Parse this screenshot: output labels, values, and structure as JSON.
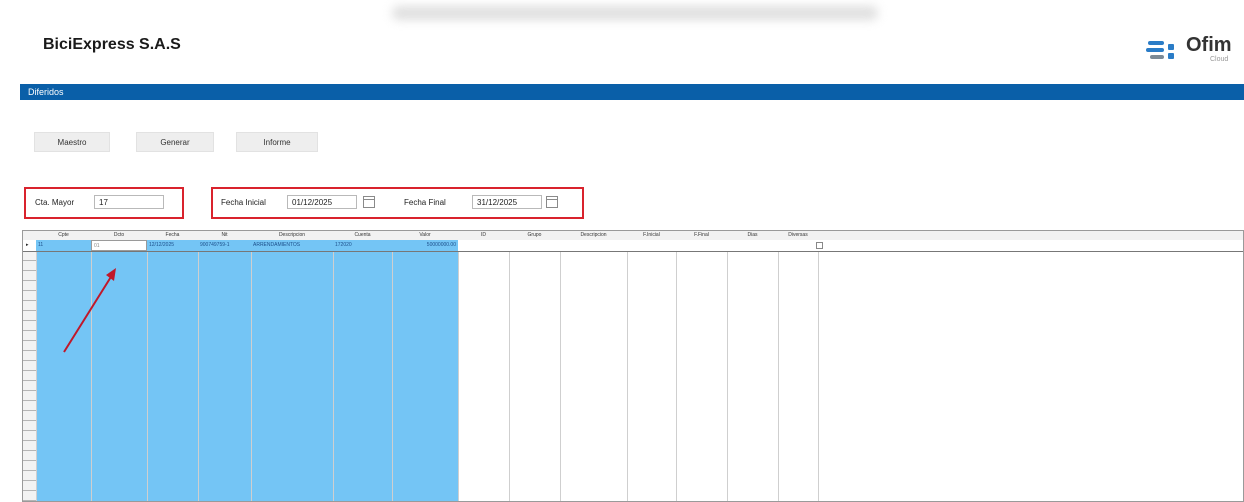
{
  "company": {
    "name": "BiciExpress S.A.S"
  },
  "logo": {
    "text": "Ofim",
    "subtitle": "Cloud",
    "icon": "ofima-logo-icon"
  },
  "window": {
    "title": "Diferidos"
  },
  "menu": [
    {
      "label": "Maestro"
    },
    {
      "label": "Generar"
    },
    {
      "label": "Informe"
    }
  ],
  "filters": {
    "cta_mayor_label": "Cta. Mayor",
    "cta_mayor_value": "17",
    "fecha_inicial_label": "Fecha Inicial",
    "fecha_inicial_value": "01/12/2025",
    "fecha_final_label": "Fecha Final",
    "fecha_final_value": "31/12/2025"
  },
  "grid": {
    "columns": [
      "Cpte",
      "Dcto",
      "Fecha",
      "Nit",
      "Descripcion",
      "Cuenta",
      "Valor",
      "ID",
      "Grupo",
      "Descripcion",
      "F.Inicial",
      "F.Final",
      "Dias",
      "Diversas"
    ],
    "row": {
      "marker": "▸",
      "cpte": "11",
      "dcto": "01",
      "fecha": "12/12/2025",
      "nit": "900749759-1",
      "descripcion": "ARRENDAMIENTOS",
      "cuenta": "172020",
      "valor": "50000000.00"
    }
  },
  "colors": {
    "title_bar": "#0a5fa8",
    "selection": "#74c5f5",
    "highlight_box": "#d9232d",
    "annotation_arrow": "#c0182a"
  }
}
